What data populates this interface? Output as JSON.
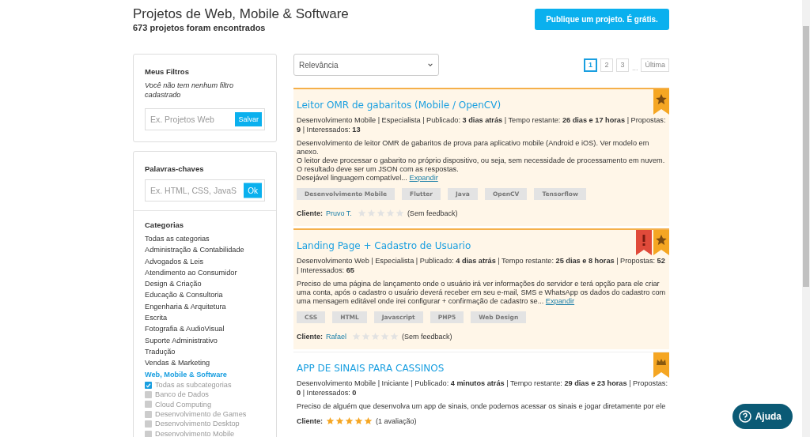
{
  "header": {
    "title": "Projetos de Web, Mobile & Software",
    "subtitle": "673 projetos foram encontrados",
    "publish_button": "Publique um projeto. É grátis."
  },
  "filters": {
    "title": "Meus Filtros",
    "empty_note": "Você não tem nenhum filtro cadastrado",
    "field": {
      "placeholder": "Ex. Projetos Web"
    },
    "save_button": "Salvar"
  },
  "keywords": {
    "title": "Palavras-chaves",
    "field": {
      "placeholder": "Ex. HTML, CSS, JavaS"
    },
    "ok_button": "Ok"
  },
  "categories": {
    "title": "Categorias",
    "items": [
      {
        "label": "Todas as categorias",
        "selected": false
      },
      {
        "label": "Administração & Contabilidade",
        "selected": false
      },
      {
        "label": "Advogados & Leis",
        "selected": false
      },
      {
        "label": "Atendimento ao Consumidor",
        "selected": false
      },
      {
        "label": "Design & Criação",
        "selected": false
      },
      {
        "label": "Educação & Consultoria",
        "selected": false
      },
      {
        "label": "Engenharia & Arquitetura",
        "selected": false
      },
      {
        "label": "Escrita",
        "selected": false
      },
      {
        "label": "Fotografia & AudioVisual",
        "selected": false
      },
      {
        "label": "Suporte Administrativo",
        "selected": false
      },
      {
        "label": "Tradução",
        "selected": false
      },
      {
        "label": "Vendas & Marketing",
        "selected": false
      },
      {
        "label": "Web, Mobile & Software",
        "selected": true
      }
    ],
    "subcategories": [
      {
        "label": "Todas as subcategorias",
        "checked": true
      },
      {
        "label": "Banco de Dados",
        "checked": false
      },
      {
        "label": "Cloud Computing",
        "checked": false
      },
      {
        "label": "Desenvolvimento de Games",
        "checked": false
      },
      {
        "label": "Desenvolvimento Desktop",
        "checked": false
      },
      {
        "label": "Desenvolvimento Mobile",
        "checked": false
      }
    ]
  },
  "sort": {
    "value": "Relevância"
  },
  "pagination": {
    "pages": [
      {
        "label": "1",
        "selected": true
      },
      {
        "label": "2",
        "selected": false
      },
      {
        "label": "3",
        "selected": false
      }
    ],
    "ellipsis": "...",
    "last": "Última"
  },
  "projects": [
    {
      "title": "Leitor OMR de gabaritos (Mobile / OpenCV)",
      "highlighted": true,
      "badges": [
        {
          "kind": "star"
        }
      ],
      "meta": "Desenvolvimento Mobile | Especialista | Publicado: **3 dias atrás** | Tempo restante: **26 dias e 17 horas** | Propostas: **9** | Interessados: **13**",
      "description": "Desenvolvimento de leitor OMR de gabaritos de prova para aplicativo mobile (Android e iOS). Ver modelo em anexo.\nO leitor deve processar o gabarito no próprio dispositivo, ou seja, sem necessidade de processamento em nuvem.\nO resultado deve ser um JSON com as respostas.\nDesejável linguagem compatível...",
      "expand": "Expandir",
      "tags": [
        "Desenvolvimento Mobile",
        "Flutter",
        "Java",
        "OpenCV",
        "Tensorflow"
      ],
      "client_label": "Cliente:",
      "client": "Pruvo T.",
      "stars": 0,
      "feedback": "(Sem feedback)"
    },
    {
      "title": "Landing Page + Cadastro de Usuario",
      "highlighted": true,
      "badges": [
        {
          "kind": "urgent"
        },
        {
          "kind": "star"
        }
      ],
      "meta": "Desenvolvimento Web | Especialista | Publicado: **4 dias atrás** | Tempo restante: **25 dias e 8 horas** | Propostas: **52** | Interessados: **65**",
      "description": "Preciso de uma página de lançamento onde o usuário irá ver informações do servidor e terá opção para ele criar uma conta, após o cadastro o usuário deverá receber em seu e-mail, SMS e WhatsApp os dados do cadastro com uma mensagem editável onde irei configurar + confirmação de cadastro se...",
      "expand": "Expandir",
      "tags": [
        "CSS",
        "HTML",
        "Javascript",
        "PHP5",
        "Web Design"
      ],
      "client_label": "Cliente:",
      "client": "Rafael",
      "stars": 0,
      "feedback": "(Sem feedback)"
    },
    {
      "title": "APP DE SINAIS PARA CASSINOS",
      "highlighted": false,
      "badges": [
        {
          "kind": "crown"
        }
      ],
      "meta": "Desenvolvimento Mobile | Iniciante | Publicado: **4 minutos atrás** | Tempo restante: **29 dias e 23 horas** | Propostas: **0** | Interessados: **0**",
      "description": "Preciso de alguém que desenvolva um app de sinais, onde podemos acessar os sinais e jogar diretamente por ele",
      "client_label": "Cliente:",
      "stars": 5,
      "feedback": "(1 avaliação)"
    }
  ],
  "help_button": "Ajuda"
}
